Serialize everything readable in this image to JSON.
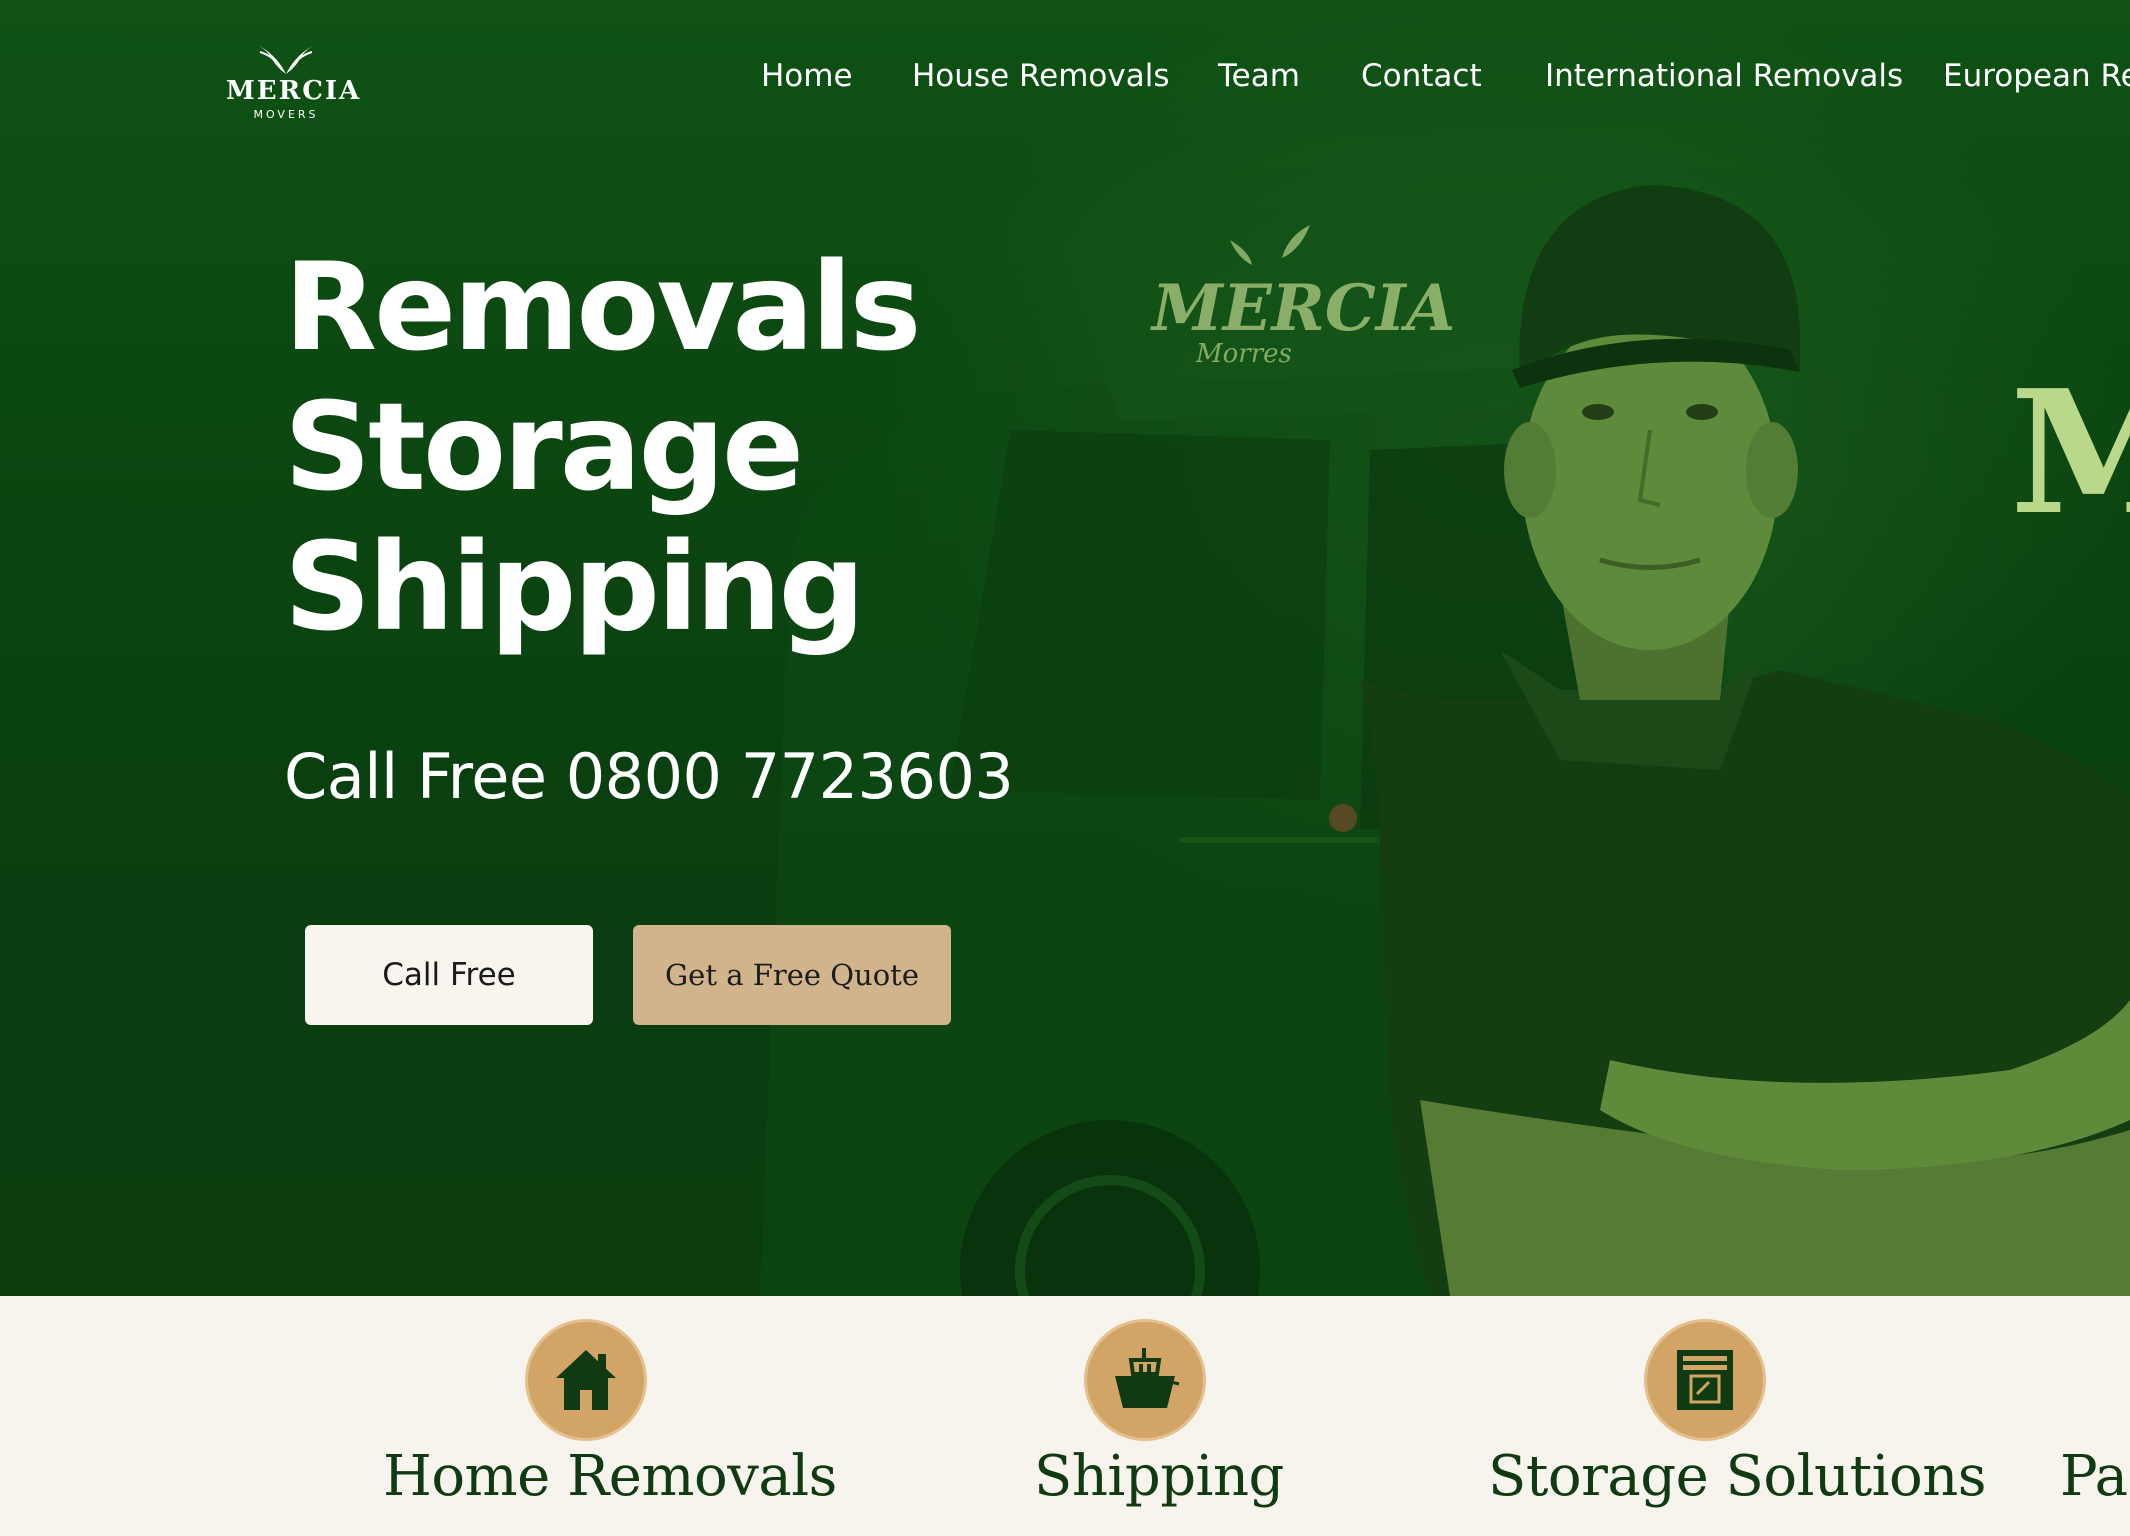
{
  "brand": {
    "name": "MERCIA",
    "tagline": "MOVERS"
  },
  "nav": {
    "items": [
      "Home",
      "House Removals",
      "Team",
      "Contact",
      "International Removals",
      "European Re"
    ]
  },
  "hero": {
    "headline": [
      "Removals",
      "Storage",
      "Shipping"
    ],
    "phone": "Call Free 0800 7723603",
    "call_button": "Call Free",
    "quote_button": "Get a Free Quote",
    "van_brand": "MERCIA",
    "van_sub": "Morres",
    "banner_letter": "M"
  },
  "services": [
    {
      "title": "Home Removals",
      "icon": "house-icon"
    },
    {
      "title": "Shipping",
      "icon": "ship-icon"
    },
    {
      "title": "Storage Solutions",
      "icon": "storage-box-icon"
    },
    {
      "title": "Pac",
      "icon": ""
    }
  ],
  "colors": {
    "hero_green": "#0b4511",
    "text_white": "#ffffff",
    "cream": "#f6f4ec",
    "tan": "#d2b48c",
    "icon_gold": "#d2a567",
    "dark_green": "#103a12",
    "banner_light_green": "#b9d889"
  }
}
